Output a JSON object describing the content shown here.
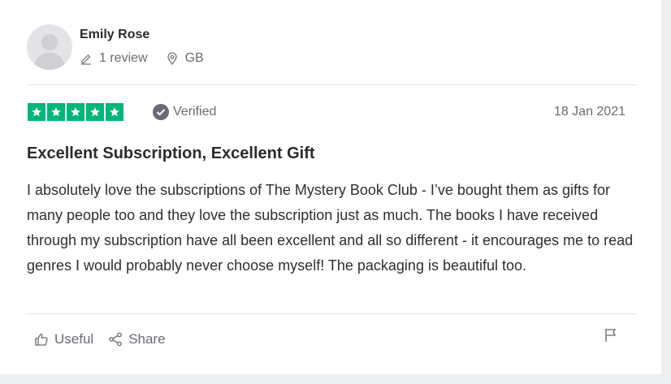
{
  "reviewer": {
    "name": "Emily Rose",
    "review_count": "1 review",
    "country": "GB"
  },
  "review": {
    "rating": 5,
    "rating_max": 5,
    "verified_label": "Verified",
    "date": "18 Jan 2021",
    "title": "Excellent Subscription, Excellent Gift",
    "body": "I absolutely love the subscriptions of The Mystery Book Club - I’ve bought them as gifts for many people too and they love the subscription just as much. The books I have received through my subscription have all been excellent and all so different - it encourages me to read genres I would probably never choose myself! The packaging is beautiful too."
  },
  "actions": {
    "useful_label": "Useful",
    "share_label": "Share"
  },
  "icons": {
    "avatar": "user-avatar-placeholder",
    "reviews": "pencil-icon",
    "location": "location-pin-icon",
    "verified": "check-badge-icon",
    "useful": "thumbs-up-icon",
    "share": "share-icon",
    "report": "flag-icon"
  },
  "colors": {
    "star_green": "#00b67a",
    "muted_text": "#6b6b73",
    "page_bg": "#edeef0"
  }
}
